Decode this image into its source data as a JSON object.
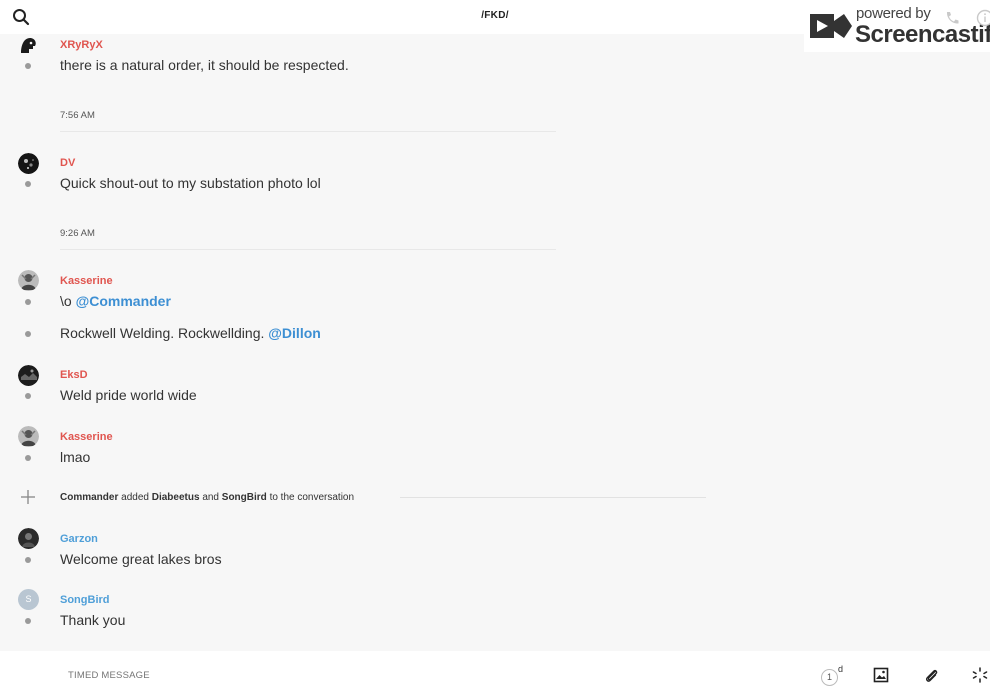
{
  "header": {
    "title": "/FKD/",
    "search_icon": "search-icon",
    "watermark": {
      "powered_by": "powered by",
      "brand": "Screencastify"
    }
  },
  "messages": [
    {
      "author": "XRyRyX",
      "author_color": "#e0554f",
      "lines": [
        "there is a natural order, it should be respected."
      ]
    },
    {
      "timestamp": "7:56 AM"
    },
    {
      "author": "DV",
      "author_color": "#e0554f",
      "lines": [
        "Quick shout-out to my substation photo lol"
      ]
    },
    {
      "timestamp": "9:26 AM"
    },
    {
      "author": "Kasserine",
      "author_color": "#e0554f",
      "lines": [
        "\\o",
        "Rockwell Welding. Rockwellding."
      ],
      "mentions": [
        "@Commander",
        "@Dillon"
      ]
    },
    {
      "author": "EksD",
      "author_color": "#e0554f",
      "lines": [
        "Weld pride world wide"
      ]
    },
    {
      "author": "Kasserine",
      "author_color": "#e0554f",
      "lines": [
        "lmao"
      ]
    },
    {
      "system": {
        "actor": "Commander",
        "verb": "added",
        "user1": "Diabeetus",
        "conj": "and",
        "user2": "SongBird",
        "suffix": "to the conversation"
      }
    },
    {
      "author": "Garzon",
      "author_color": "#4f9fd8",
      "lines": [
        "Welcome great lakes bros"
      ]
    },
    {
      "author": "SongBird",
      "author_color": "#4f9fd8",
      "avatar_letter": "S",
      "lines": [
        "Thank you"
      ]
    }
  ],
  "composer": {
    "placeholder": "TIMED MESSAGE",
    "timer_value": "1",
    "timer_unit": "d"
  }
}
